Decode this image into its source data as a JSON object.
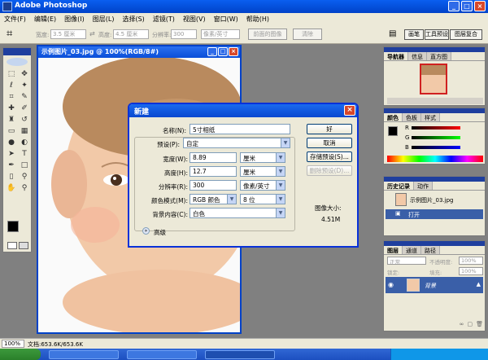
{
  "app": {
    "title": "Adobe Photoshop"
  },
  "menu": [
    "文件(F)",
    "编辑(E)",
    "图像(I)",
    "图层(L)",
    "选择(S)",
    "滤镜(T)",
    "视图(V)",
    "窗口(W)",
    "帮助(H)"
  ],
  "options_bar": {
    "width_label": "宽度:",
    "width_value": "3.5 厘米",
    "height_label": "高度:",
    "height_value": "4.5 厘米",
    "resolution_label": "分辨率:",
    "resolution_value": "300",
    "resolution_unit": "像素/英寸",
    "front_image_button": "前面的图像",
    "clear_button": "清除",
    "tabs": [
      "画笔",
      "工具预设",
      "图层复合"
    ]
  },
  "document": {
    "title": "示例图片_03.jpg @ 100%(RGB/8#)"
  },
  "navigator_panel": {
    "tabs": [
      "导航器",
      "信息",
      "直方图"
    ]
  },
  "color_panel": {
    "tabs": [
      "颜色",
      "色板",
      "样式"
    ],
    "channels": [
      "R",
      "G",
      "B"
    ]
  },
  "history_panel": {
    "tabs": [
      "历史记录",
      "动作"
    ],
    "snapshot": "示例图片_03.jpg",
    "item": "打开"
  },
  "layers_panel": {
    "tabs": [
      "图层",
      "通道",
      "路径"
    ],
    "blend_mode": "正常",
    "opacity_label": "不透明度:",
    "opacity_value": "100%",
    "lock_label": "锁定:",
    "fill_label": "填充:",
    "fill_value": "100%",
    "layer_name": "背景"
  },
  "dialog": {
    "title": "新建",
    "name_label": "名称(N):",
    "name_value": "5寸相纸",
    "preset_label": "预设(P):",
    "preset_value": "自定",
    "width_label": "宽度(W):",
    "width_value": "8.89",
    "width_unit": "厘米",
    "height_label": "高度(H):",
    "height_value": "12.7",
    "height_unit": "厘米",
    "resolution_label": "分辨率(R):",
    "resolution_value": "300",
    "resolution_unit": "像素/英寸",
    "color_mode_label": "颜色模式(M):",
    "color_mode_value": "RGB 颜色",
    "color_depth_value": "8 位",
    "background_label": "背景内容(C):",
    "background_value": "白色",
    "advanced_label": "高级",
    "ok_button": "好",
    "cancel_button": "取消",
    "save_preset_button": "存储预设(S)...",
    "delete_preset_button": "删除预设(D)...",
    "image_size_label": "图像大小:",
    "image_size_value": "4.51M"
  },
  "status_bar": {
    "zoom": "100%",
    "doc_info": "文档:653.6K/653.6K"
  },
  "colors": {
    "title_blue": "#0a4ed8",
    "panel_bg": "#ece9d8",
    "workspace": "#808080",
    "selected_row": "#3a5fa8"
  }
}
